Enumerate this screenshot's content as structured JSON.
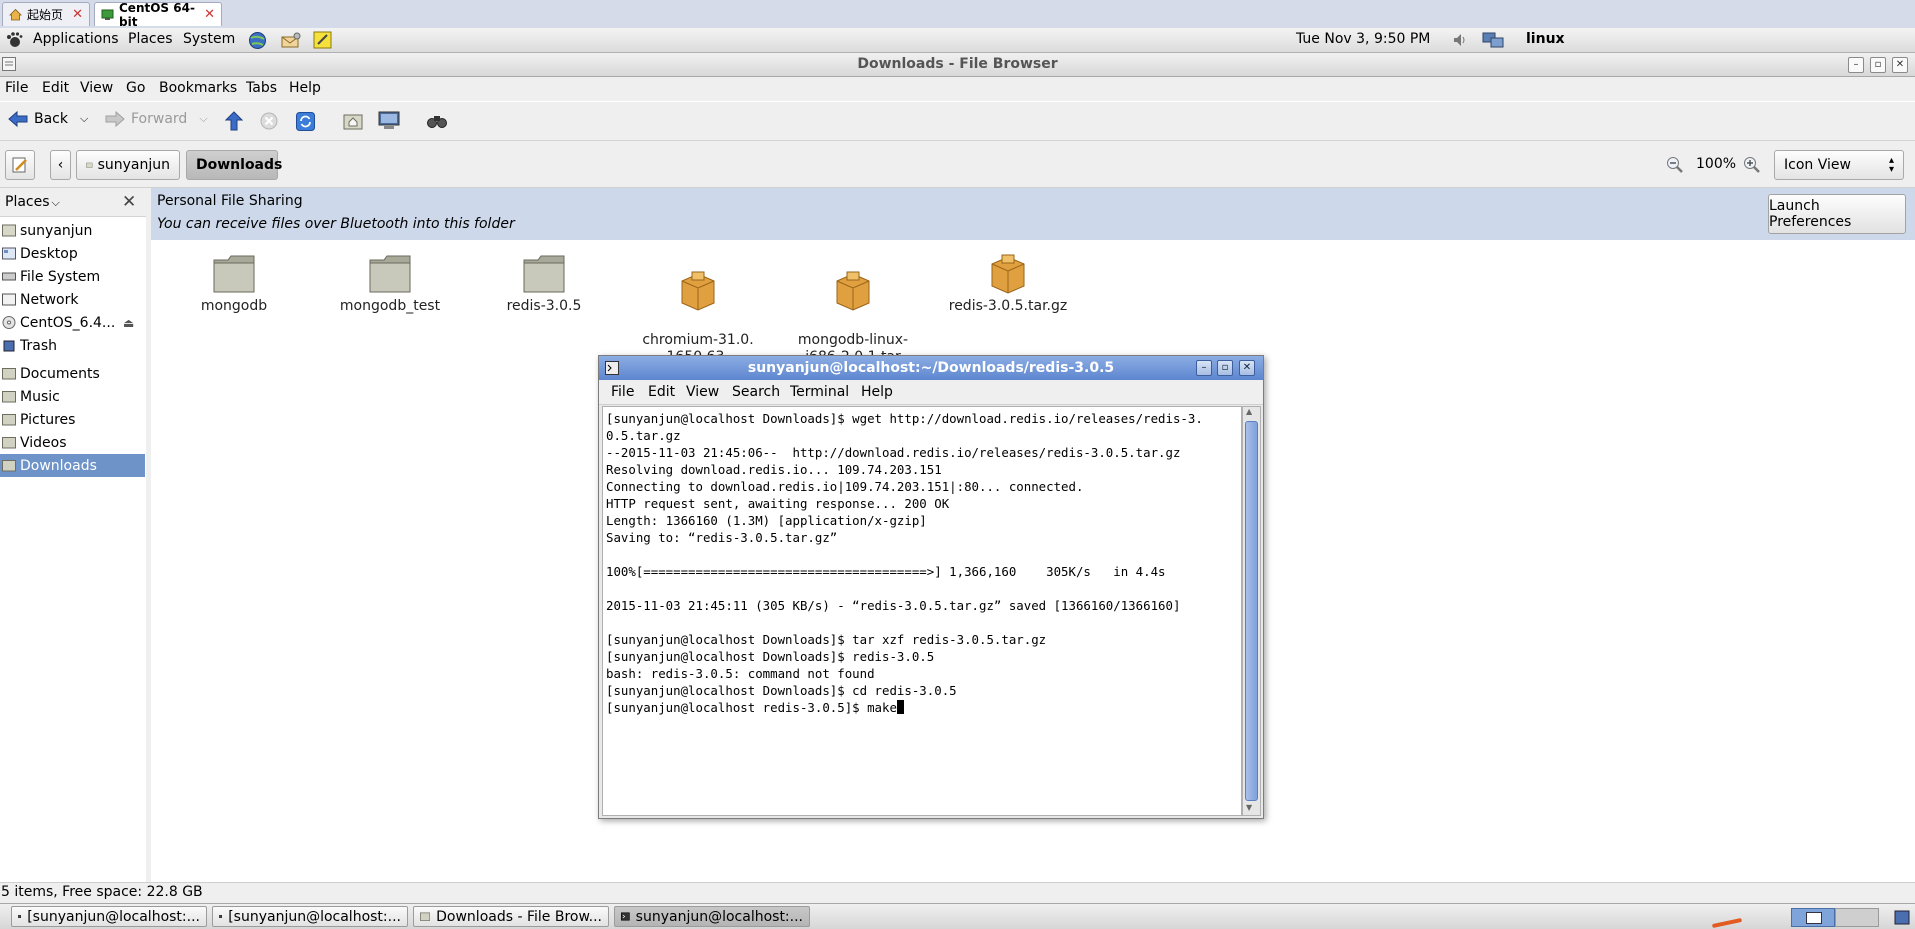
{
  "vm_tabs": [
    {
      "label": "起始页"
    },
    {
      "label": "CentOS 64-bit"
    }
  ],
  "top_panel": {
    "menus": [
      "Applications",
      "Places",
      "System"
    ],
    "clock": "Tue Nov  3,  9:50 PM",
    "user": "linux"
  },
  "window": {
    "title": "Downloads - File Browser"
  },
  "menubar": [
    "File",
    "Edit",
    "View",
    "Go",
    "Bookmarks",
    "Tabs",
    "Help"
  ],
  "toolbar": {
    "back": "Back",
    "forward": "Forward"
  },
  "location": {
    "crumbs": [
      "sunyanjun",
      "Downloads"
    ],
    "zoom": "100%",
    "view_mode": "Icon View"
  },
  "sidebar": {
    "header": "Places",
    "items": [
      "sunyanjun",
      "Desktop",
      "File System",
      "Network",
      "CentOS_6.4...",
      "Trash",
      "Documents",
      "Music",
      "Pictures",
      "Videos",
      "Downloads"
    ],
    "selected": "Downloads"
  },
  "sharing": {
    "title": "Personal File Sharing",
    "message": "You can receive files over Bluetooth into this folder",
    "button": "Launch Preferences"
  },
  "files": [
    {
      "name": "mongodb",
      "type": "folder"
    },
    {
      "name": "mongodb_test",
      "type": "folder"
    },
    {
      "name": "redis-3.0.5",
      "type": "folder"
    },
    {
      "name": "chromium-31.0.\n1650.63-2.el6.i686.\nrpm",
      "type": "package"
    },
    {
      "name": "mongodb-linux-\ni686-2.0.1.tar",
      "type": "package"
    },
    {
      "name": "redis-3.0.5.tar.gz",
      "type": "package"
    }
  ],
  "status": "5 items, Free space: 22.8 GB",
  "taskbar": [
    {
      "label": "[sunyanjun@localhost:..."
    },
    {
      "label": "[sunyanjun@localhost:..."
    },
    {
      "label": "Downloads - File Brow..."
    },
    {
      "label": "sunyanjun@localhost:..."
    }
  ],
  "terminal": {
    "title": "sunyanjun@localhost:~/Downloads/redis-3.0.5",
    "menus": [
      "File",
      "Edit",
      "View",
      "Search",
      "Terminal",
      "Help"
    ],
    "lines": [
      "[sunyanjun@localhost Downloads]$ wget http://download.redis.io/releases/redis-3.",
      "0.5.tar.gz",
      "--2015-11-03 21:45:06--  http://download.redis.io/releases/redis-3.0.5.tar.gz",
      "Resolving download.redis.io... 109.74.203.151",
      "Connecting to download.redis.io|109.74.203.151|:80... connected.",
      "HTTP request sent, awaiting response... 200 OK",
      "Length: 1366160 (1.3M) [application/x-gzip]",
      "Saving to: “redis-3.0.5.tar.gz”",
      "",
      "100%[======================================>] 1,366,160    305K/s   in 4.4s",
      "",
      "2015-11-03 21:45:11 (305 KB/s) - “redis-3.0.5.tar.gz” saved [1366160/1366160]",
      "",
      "[sunyanjun@localhost Downloads]$ tar xzf redis-3.0.5.tar.gz",
      "[sunyanjun@localhost Downloads]$ redis-3.0.5",
      "bash: redis-3.0.5: command not found",
      "[sunyanjun@localhost Downloads]$ cd redis-3.0.5"
    ],
    "prompt": "[sunyanjun@localhost redis-3.0.5]$ ",
    "input": "make"
  },
  "colors": {
    "selection": "#6d93c9",
    "share_bar": "#cdd9ea",
    "terminal_title": "#5d86cf",
    "folder": "#b8b8a8",
    "package": "#e0a040"
  }
}
